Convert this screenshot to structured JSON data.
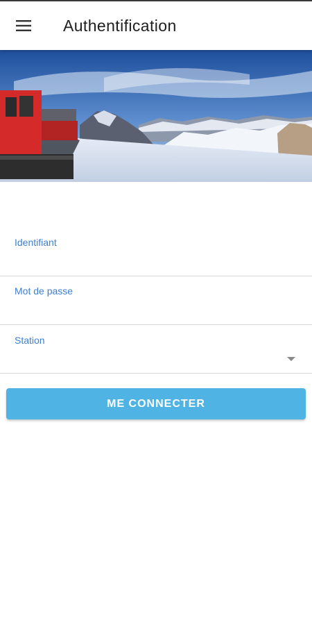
{
  "appbar": {
    "title": "Authentification",
    "menu_icon": "hamburger-menu-icon"
  },
  "hero": {
    "image": "snowy mountain panorama with red snow groomer"
  },
  "form": {
    "identifiant": {
      "label": "Identifiant",
      "value": ""
    },
    "mot_de_passe": {
      "label": "Mot de passe",
      "value": ""
    },
    "station": {
      "label": "Station",
      "selected": "",
      "dropdown_icon": "caret-down-icon"
    },
    "submit_label": "ME CONNECTER"
  },
  "colors": {
    "accent_label": "#3d7fd4",
    "button": "#4fb3e3",
    "button_text": "#ffffff"
  }
}
